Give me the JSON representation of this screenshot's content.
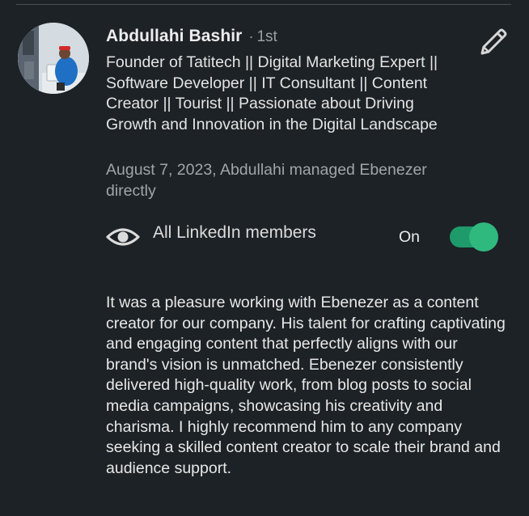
{
  "recommender": {
    "name": "Abdullahi Bashir",
    "separator": "·",
    "connection_degree": "1st",
    "headline": "Founder of Tatitech || Digital Marketing Expert || Software Developer || IT Consultant || Content Creator || Tourist || Passionate about Driving Growth and Innovation in the Digital Landscape",
    "relationship": "August 7, 2023, Abdullahi managed Ebenezer directly",
    "avatar_icon": "profile-photo"
  },
  "actions": {
    "edit_icon": "pencil-icon"
  },
  "visibility": {
    "icon": "eye-icon",
    "label": "All LinkedIn members",
    "toggle_state_label": "On",
    "toggle_on": true,
    "accent_color": "#2fb97f"
  },
  "recommendation": {
    "text": "It was a pleasure working with Ebenezer as a content creator for our company. His talent for crafting captivating and engaging content that perfectly aligns with our brand's vision is unmatched. Ebenezer consistently delivered high-quality work, from blog posts to social media campaigns, showcasing his creativity and charisma. I highly recommend him to any company seeking a skilled content creator to scale their brand and audience support."
  }
}
